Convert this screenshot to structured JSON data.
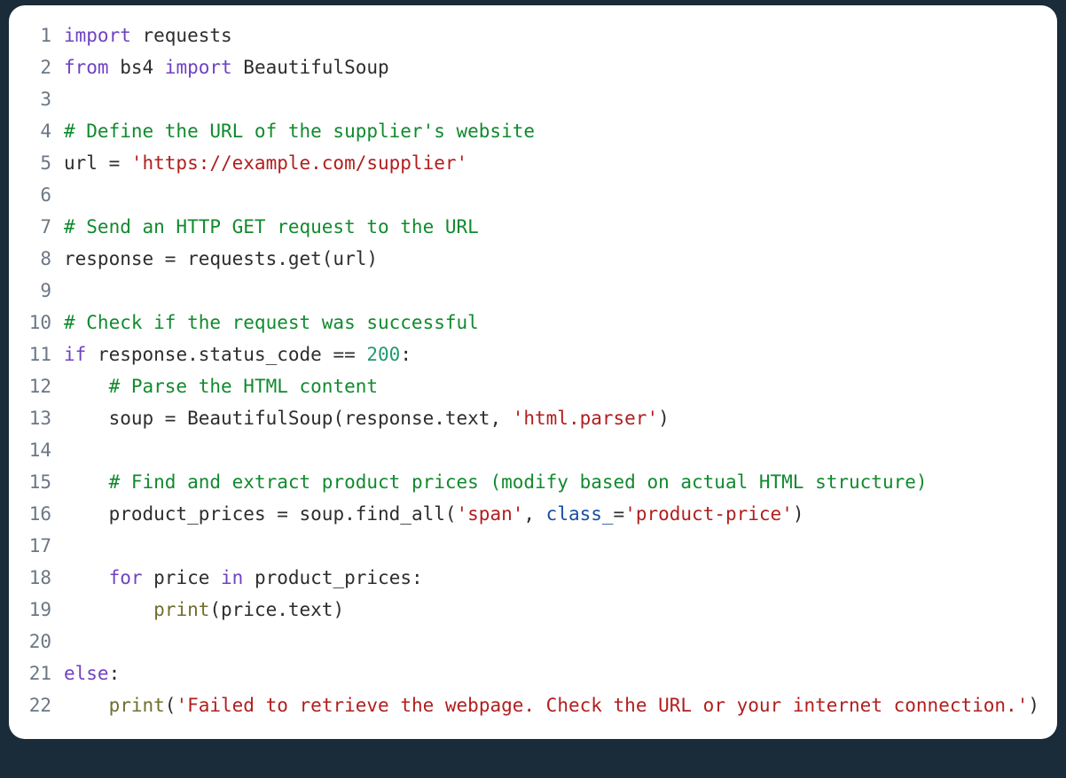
{
  "lines": {
    "n1": "1",
    "n2": "2",
    "n3": "3",
    "n4": "4",
    "n5": "5",
    "n6": "6",
    "n7": "7",
    "n8": "8",
    "n9": "9",
    "n10": "10",
    "n11": "11",
    "n12": "12",
    "n13": "13",
    "n14": "14",
    "n15": "15",
    "n16": "16",
    "n17": "17",
    "n18": "18",
    "n19": "19",
    "n20": "20",
    "n21": "21",
    "n22": "22"
  },
  "t": {
    "import": "import",
    "from": "from",
    "for": "for",
    "in": "in",
    "if": "if",
    "else": "else",
    "requests": " requests",
    "bs4": " bs4 ",
    "BeautifulSoup": " BeautifulSoup",
    "cmt_url": "# Define the URL of the supplier's website",
    "url_assign": "url = ",
    "url_str": "'https://example.com/supplier'",
    "cmt_get": "# Send an HTTP GET request to the URL",
    "resp_assign": "response = requests.get(url)",
    "cmt_check": "# Check if the request was successful",
    "if_resp": " response.status_code == ",
    "num200": "200",
    "colon": ":",
    "cmt_parse": "    # Parse the HTML content",
    "soup_assign": "    soup = BeautifulSoup(response.text, ",
    "html_parser": "'html.parser'",
    "close_paren": ")",
    "cmt_find": "    # Find and extract product prices (modify based on actual HTML structure)",
    "pp_assign": "    product_prices = soup.find_all(",
    "span_str": "'span'",
    "comma_sp": ", ",
    "class_kw": "class_",
    "eq": "=",
    "pp_str": "'product-price'",
    "for_line_a": "    ",
    "for_price": " price ",
    "for_in_pp": " product_prices",
    "print_indent": "        ",
    "print_fn": "print",
    "print_arg": "(price.text)",
    "else_kw": "",
    "fail_indent": "    ",
    "fail_str_a": "'Failed to retrieve the webpage. Check the URL or your internet con",
    "fail_str_b": "nection.'",
    "open_paren": "("
  }
}
